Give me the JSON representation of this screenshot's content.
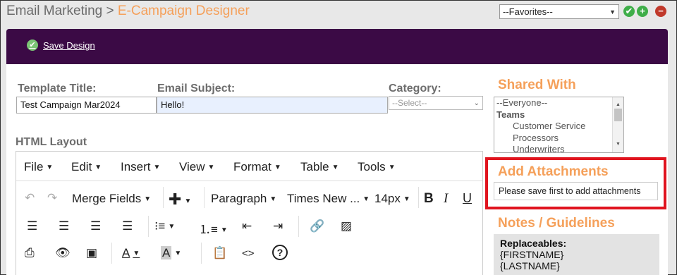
{
  "breadcrumb": {
    "parent": "Email Marketing",
    "separator": " > ",
    "current": "E-Campaign Designer"
  },
  "favorites": {
    "selected": "--Favorites--"
  },
  "header_actions": {
    "confirm": "✔",
    "add": "+",
    "remove": "−"
  },
  "toolbar": {
    "save_label": "Save Design"
  },
  "form": {
    "template_title_label": "Template Title:",
    "template_title_value": "Test Campaign Mar2024",
    "email_subject_label": "Email Subject:",
    "email_subject_value": "Hello!",
    "category_label": "Category:",
    "category_value": "--Select--",
    "html_layout_label": "HTML Layout"
  },
  "editor": {
    "menus": [
      {
        "label": "File"
      },
      {
        "label": "Edit"
      },
      {
        "label": "Insert"
      },
      {
        "label": "View"
      },
      {
        "label": "Format"
      },
      {
        "label": "Table"
      },
      {
        "label": "Tools"
      }
    ],
    "merge_fields": "Merge Fields",
    "block_format": "Paragraph",
    "font_family": "Times New ...",
    "font_size": "14px",
    "bold": "B",
    "italic": "I",
    "underline": "U",
    "text_color": "A",
    "bg_color": "A",
    "code": "<>",
    "help": "?"
  },
  "sidebar": {
    "shared_with_heading": "Shared With",
    "shared_items": [
      {
        "label": "--Everyone--",
        "type": "option"
      },
      {
        "label": "Teams",
        "type": "group"
      },
      {
        "label": "Customer Service",
        "type": "sub"
      },
      {
        "label": "Processors",
        "type": "sub"
      },
      {
        "label": "Underwriters",
        "type": "sub"
      }
    ],
    "attachments_heading": "Add Attachments",
    "attachments_note": "Please save first to add attachments",
    "notes_heading": "Notes / Guidelines",
    "replaceables_label": "Replaceables:",
    "replaceables": [
      "{FIRSTNAME}",
      "{LASTNAME}"
    ]
  },
  "colors": {
    "accent_orange": "#f5a05a",
    "topbar_purple": "#3b0a45",
    "highlight_red": "#e0141e",
    "success_green": "#3fae49"
  }
}
